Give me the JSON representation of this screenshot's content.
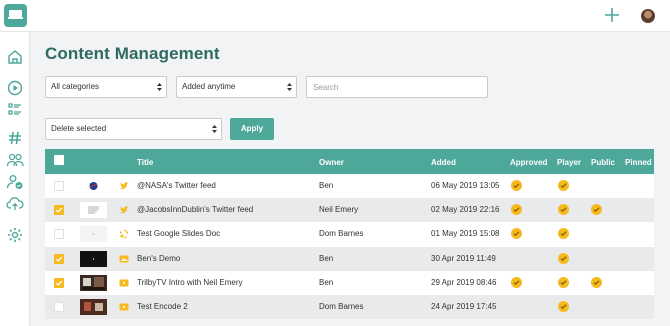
{
  "header": {
    "logo": "tv-logo-icon",
    "add_icon": "plus-icon",
    "avatar": "user-avatar"
  },
  "sidebar": {
    "items": [
      "home-icon",
      "play-icon",
      "list-icon",
      "hashtag-icon",
      "users-icon",
      "user-check-icon",
      "cloud-upload-icon",
      "gear-icon"
    ]
  },
  "page": {
    "title": "Content Management"
  },
  "filters": {
    "category": "All categories",
    "time": "Added anytime",
    "search_placeholder": "Search",
    "bulk_action": "Delete selected",
    "apply_label": "Apply"
  },
  "table": {
    "columns": {
      "title": "Title",
      "owner": "Owner",
      "added": "Added",
      "approved": "Approved",
      "player": "Player",
      "public": "Public",
      "pinned": "Pinned"
    },
    "rows": [
      {
        "checked": false,
        "type": "twitter",
        "thumb": "nasa",
        "title": "@NASA's Twitter feed",
        "owner": "Ben",
        "added": "06 May 2019 13:05",
        "approved": true,
        "player": true,
        "public": false,
        "pinned": false
      },
      {
        "checked": true,
        "type": "twitter",
        "thumb": "doc",
        "title": "@JacobsInnDublin's Twitter feed",
        "owner": "Neil Emery",
        "added": "02 May 2019 22:16",
        "approved": true,
        "player": true,
        "public": true,
        "pinned": false
      },
      {
        "checked": false,
        "type": "slides",
        "thumb": "blank",
        "title": "Test Google Slides Doc",
        "owner": "Dom Barnes",
        "added": "01 May 2019 15:08",
        "approved": true,
        "player": true,
        "public": false,
        "pinned": false
      },
      {
        "checked": true,
        "type": "image",
        "thumb": "dark",
        "title": "Ben's Demo",
        "owner": "Ben",
        "added": "30 Apr 2019 11:49",
        "approved": false,
        "player": true,
        "public": false,
        "pinned": false
      },
      {
        "checked": true,
        "type": "video",
        "thumb": "video",
        "title": "TrilbyTV Intro with Neil Emery",
        "owner": "Ben",
        "added": "29 Apr 2019 08:46",
        "approved": true,
        "player": true,
        "public": true,
        "pinned": false
      },
      {
        "checked": false,
        "type": "video",
        "thumb": "video2",
        "title": "Test Encode 2",
        "owner": "Dom Barnes",
        "added": "24 Apr 2019 17:45",
        "approved": false,
        "player": true,
        "public": false,
        "pinned": false
      }
    ]
  }
}
